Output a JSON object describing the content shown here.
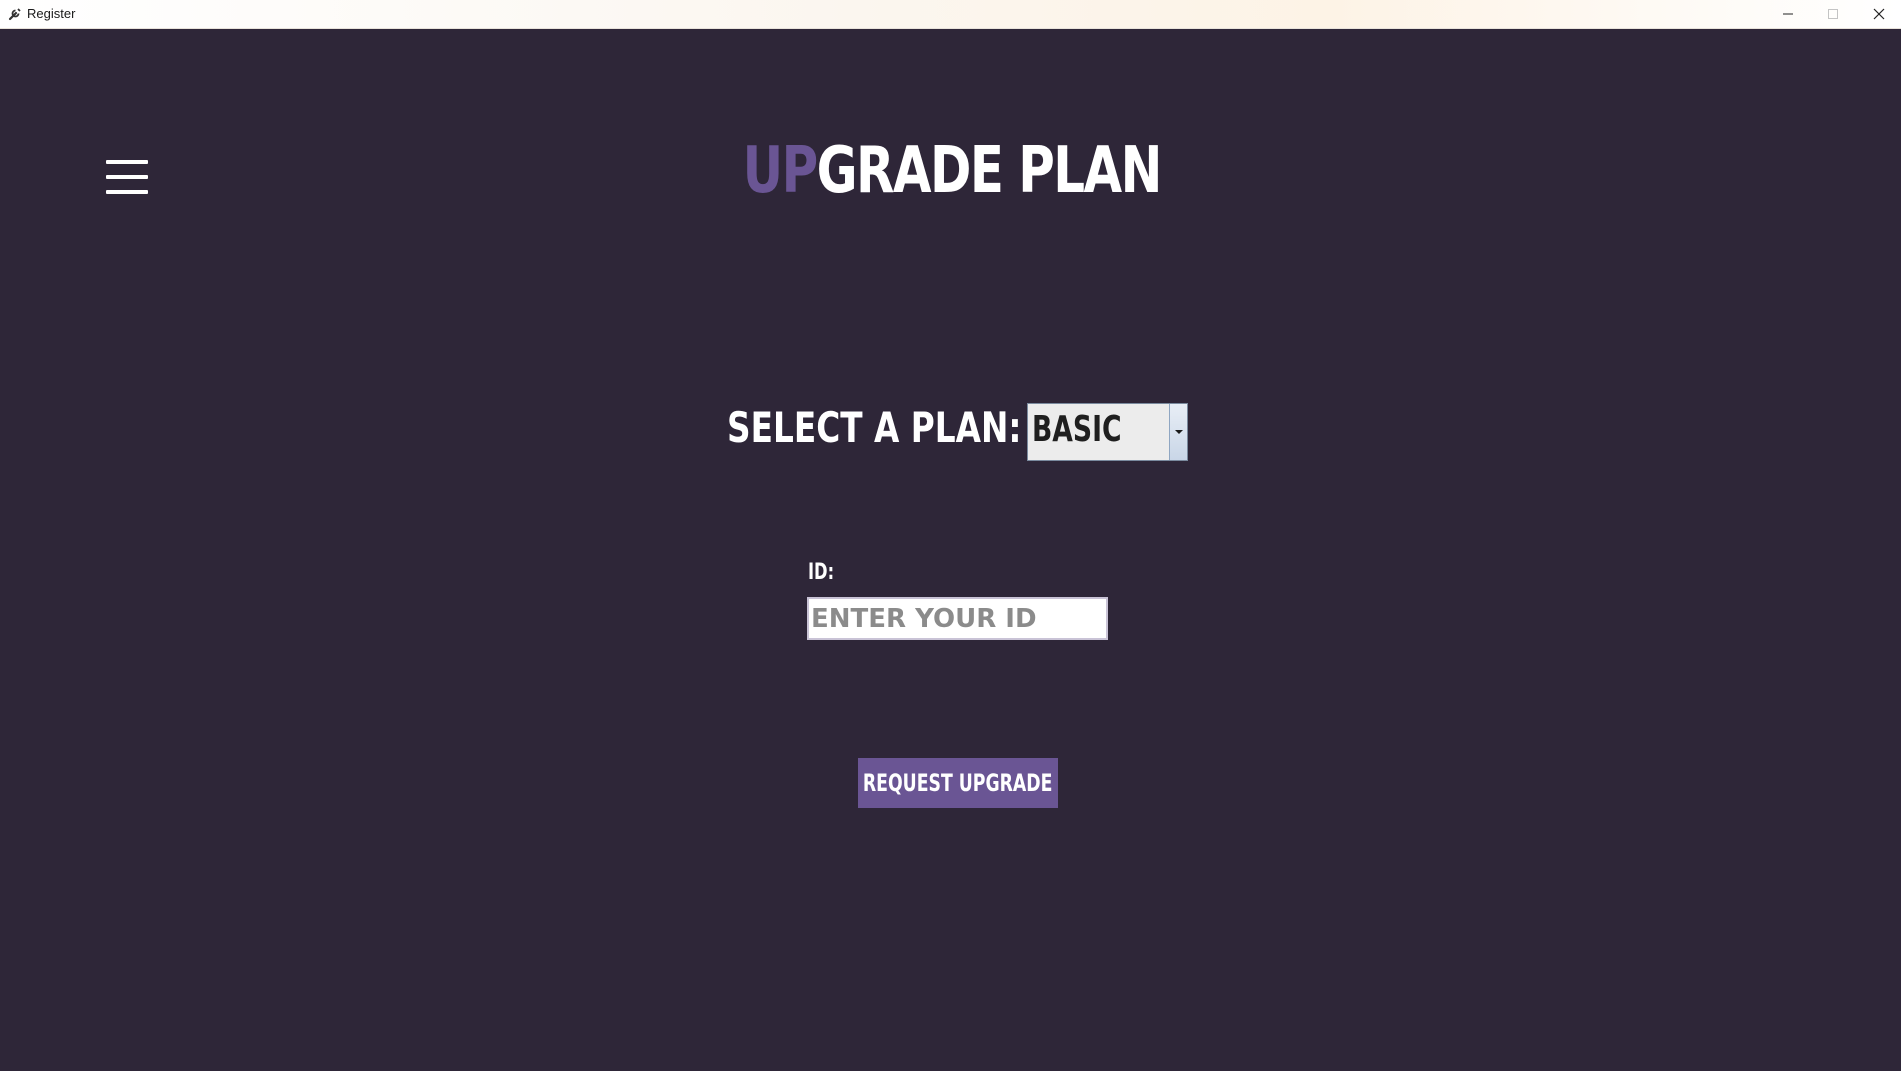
{
  "window": {
    "title": "Register",
    "app_icon": "tools-icon",
    "controls": {
      "minimize": "minimize-icon",
      "maximize": "maximize-icon",
      "close": "close-icon"
    }
  },
  "nav": {
    "menu_icon": "hamburger-menu-icon"
  },
  "header": {
    "title_accent": "UP",
    "title_rest": "GRADE PLAN"
  },
  "form": {
    "plan_label": "SELECT A PLAN:",
    "plan_selected": "BASIC",
    "id_label": "ID:",
    "id_placeholder": "ENTER YOUR ID",
    "id_value": "",
    "submit_label": "REQUEST UPGRADE"
  },
  "colors": {
    "background": "#2e2638",
    "accent": "#6a5594",
    "text": "#ffffff"
  }
}
